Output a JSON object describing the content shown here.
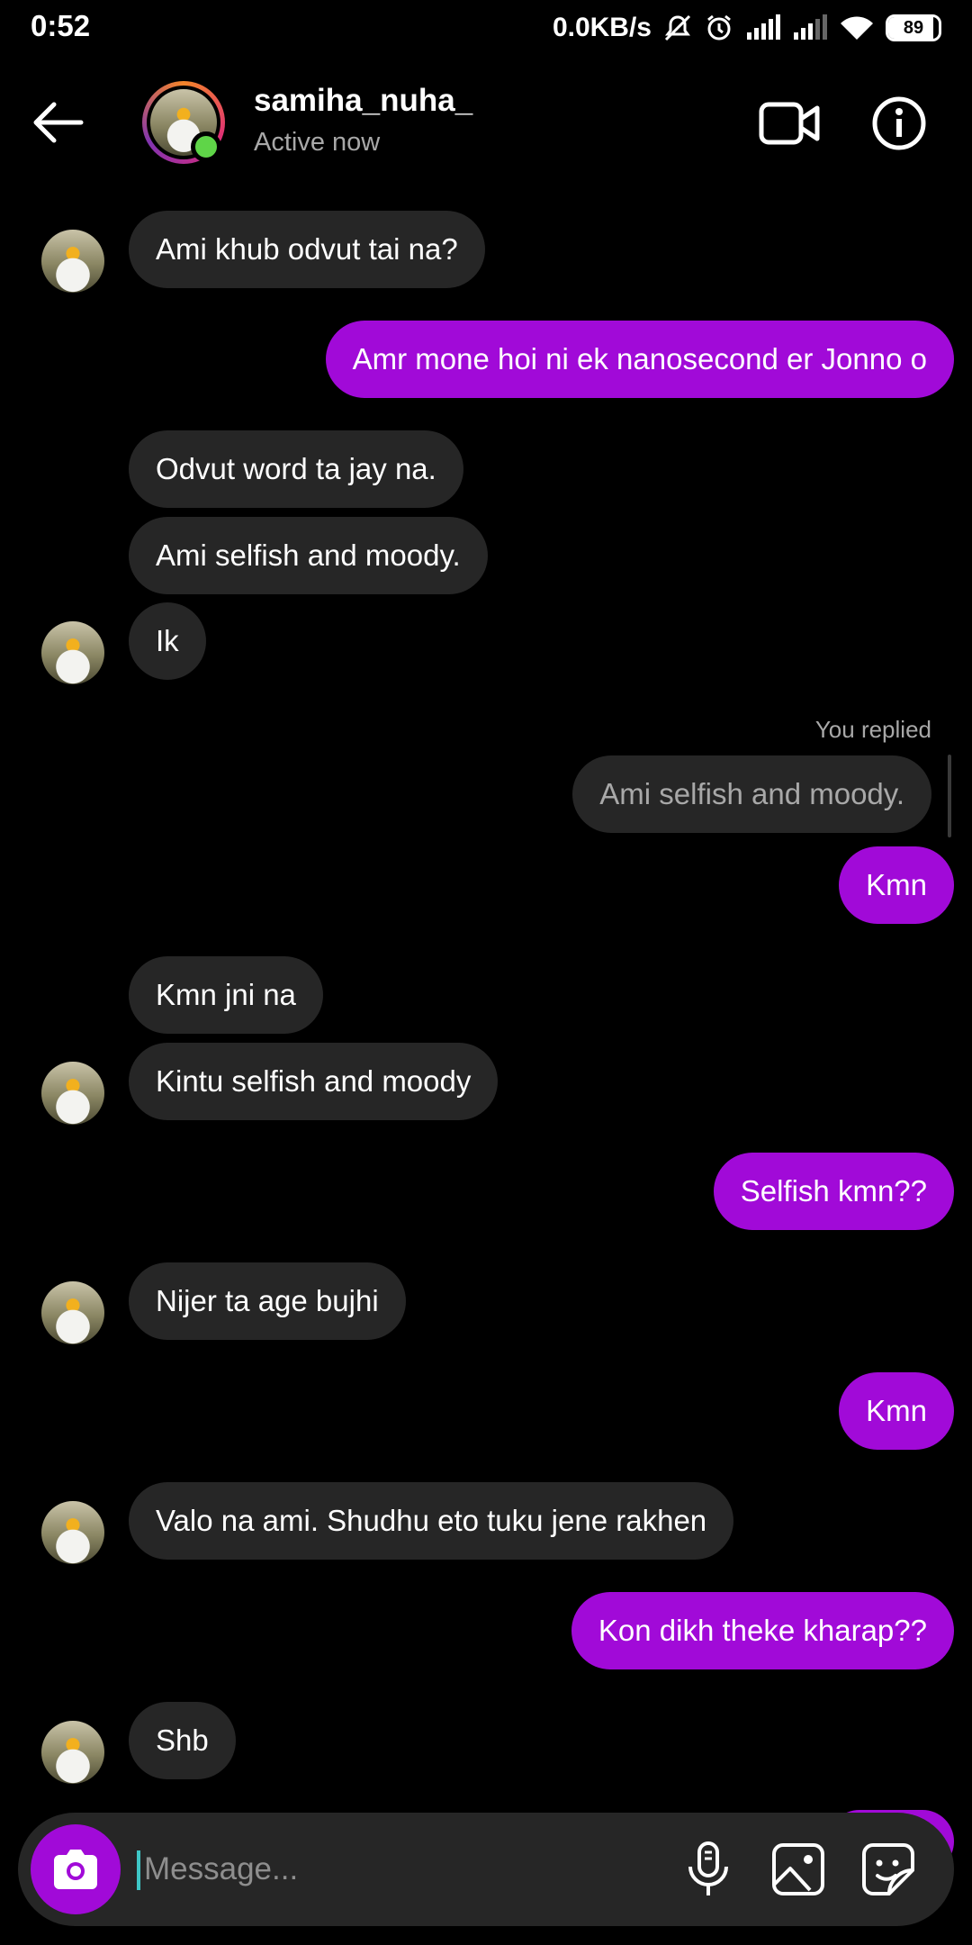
{
  "status_bar": {
    "time": "0:52",
    "network_speed": "0.0KB/s",
    "battery": "89",
    "icons": [
      "mute-icon",
      "alarm-icon",
      "signal-icon",
      "signal-icon",
      "wifi-icon",
      "battery-icon"
    ]
  },
  "header": {
    "username": "samiha_nuha_",
    "status": "Active now",
    "icons": [
      "back-arrow-icon",
      "video-call-icon",
      "info-icon"
    ]
  },
  "messages": [
    {
      "side": "in",
      "text": "Ami khub odvut tai na?"
    },
    {
      "side": "out",
      "text": "Amr mone hoi ni ek nanosecond er Jonno o"
    },
    {
      "side": "in",
      "text": "Odvut word ta jay na."
    },
    {
      "side": "in",
      "text": "Ami selfish and moody."
    },
    {
      "side": "in",
      "text": "Ik"
    },
    {
      "side": "out",
      "reply_label": "You replied",
      "quoted": "Ami selfish and moody.",
      "text": "Kmn"
    },
    {
      "side": "in",
      "text": "Kmn jni na"
    },
    {
      "side": "in",
      "text": "Kintu selfish and moody"
    },
    {
      "side": "out",
      "text": "Selfish kmn??"
    },
    {
      "side": "in",
      "text": "Nijer ta age bujhi"
    },
    {
      "side": "out",
      "text": "Kmn"
    },
    {
      "side": "in",
      "text": "Valo na ami. Shudhu eto tuku jene rakhen"
    },
    {
      "side": "out",
      "text": "Kon dikh theke kharap??"
    },
    {
      "side": "in",
      "text": "Shb"
    }
  ],
  "composer": {
    "placeholder": "Message...",
    "icons": [
      "camera-icon",
      "microphone-icon",
      "gallery-icon",
      "sticker-icon"
    ]
  },
  "colors": {
    "background": "#000000",
    "incoming_bubble": "#262626",
    "outgoing_bubble": "#a10ad8",
    "online": "#5fd548",
    "secondary_text": "#a8a8a8"
  }
}
